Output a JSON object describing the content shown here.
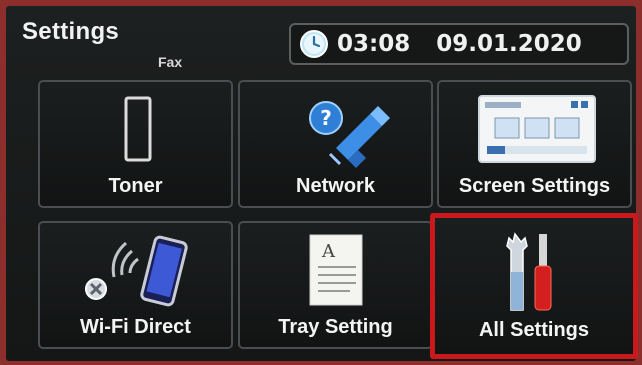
{
  "header": {
    "title": "Settings",
    "subtitle": "Fax",
    "time": "03:08",
    "date": "09.01.2020"
  },
  "tiles": [
    {
      "label": "Toner",
      "icon": "toner-icon"
    },
    {
      "label": "Network",
      "icon": "network-icon"
    },
    {
      "label": "Screen Settings",
      "icon": "screen-settings-icon"
    },
    {
      "label": "Wi-Fi Direct",
      "icon": "wifi-direct-icon"
    },
    {
      "label": "Tray Setting",
      "icon": "tray-setting-icon"
    },
    {
      "label": "All Settings",
      "icon": "all-settings-icon"
    }
  ],
  "colors": {
    "selection_border": "#c9191c",
    "background": "#151717"
  }
}
